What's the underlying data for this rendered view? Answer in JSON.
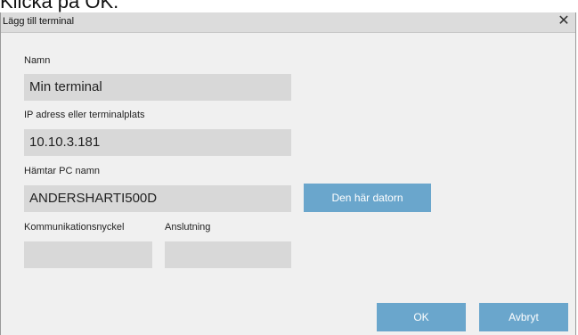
{
  "caption": "Klicka på OK.",
  "dialog": {
    "title": "Lägg till terminal",
    "close_icon": "close-icon",
    "fields": {
      "name": {
        "label": "Namn",
        "value": "Min terminal"
      },
      "ip": {
        "label": "IP adress eller terminalplats",
        "value": "10.10.3.181"
      },
      "pc_name": {
        "label": "Hämtar PC namn",
        "value": "ANDERSHARTI500D"
      },
      "comm_key": {
        "label": "Kommunikationsnyckel",
        "value": ""
      },
      "connection": {
        "label": "Anslutning",
        "value": ""
      }
    },
    "buttons": {
      "this_computer": "Den här datorn",
      "ok": "OK",
      "cancel": "Avbryt"
    },
    "colors": {
      "button": "#6aa6cc",
      "field": "#d8d8d8",
      "background": "#f0f0f0",
      "titlebar": "#dcdcdc"
    }
  }
}
